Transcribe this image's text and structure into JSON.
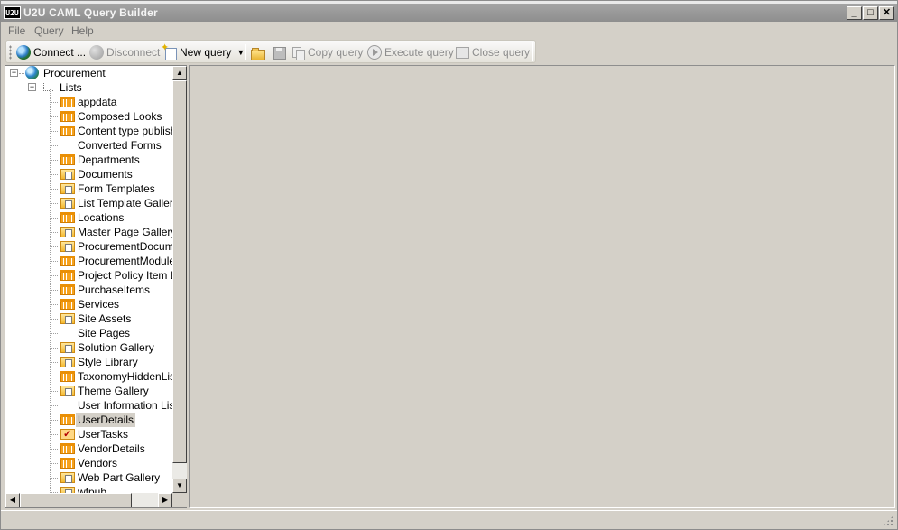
{
  "window": {
    "title": "U2U CAML Query Builder",
    "logo_text": "U2U",
    "controls": {
      "minimize": "_",
      "maximize": "□",
      "close": "✕"
    }
  },
  "menu": [
    "File",
    "Query",
    "Help"
  ],
  "toolbar": {
    "connect": "Connect ...",
    "disconnect": "Disconnect",
    "new_query": "New query",
    "copy_query": "Copy query",
    "execute_query": "Execute query",
    "close_query": "Close query"
  },
  "tree": {
    "root": "Procurement",
    "lists_node": "Lists",
    "items": [
      {
        "label": "appdata",
        "icon": "list"
      },
      {
        "label": "Composed Looks",
        "icon": "list"
      },
      {
        "label": "Content type publishing",
        "icon": "list"
      },
      {
        "label": "Converted Forms",
        "icon": "none"
      },
      {
        "label": "Departments",
        "icon": "list"
      },
      {
        "label": "Documents",
        "icon": "library"
      },
      {
        "label": "Form Templates",
        "icon": "library"
      },
      {
        "label": "List Template Gallery",
        "icon": "library"
      },
      {
        "label": "Locations",
        "icon": "list"
      },
      {
        "label": "Master Page Gallery",
        "icon": "library"
      },
      {
        "label": "ProcurementDocuments",
        "icon": "library"
      },
      {
        "label": "ProcurementModuleEx",
        "icon": "list"
      },
      {
        "label": "Project Policy Item List",
        "icon": "list"
      },
      {
        "label": "PurchaseItems",
        "icon": "list"
      },
      {
        "label": "Services",
        "icon": "list"
      },
      {
        "label": "Site Assets",
        "icon": "library"
      },
      {
        "label": "Site Pages",
        "icon": "none"
      },
      {
        "label": "Solution Gallery",
        "icon": "library"
      },
      {
        "label": "Style Library",
        "icon": "library"
      },
      {
        "label": "TaxonomyHiddenList",
        "icon": "list"
      },
      {
        "label": "Theme Gallery",
        "icon": "library"
      },
      {
        "label": "User Information List",
        "icon": "none"
      },
      {
        "label": "UserDetails",
        "icon": "list",
        "selected": true
      },
      {
        "label": "UserTasks",
        "icon": "task"
      },
      {
        "label": "VendorDetails",
        "icon": "list"
      },
      {
        "label": "Vendors",
        "icon": "list"
      },
      {
        "label": "Web Part Gallery",
        "icon": "library"
      },
      {
        "label": "wfpub",
        "icon": "library"
      }
    ]
  }
}
